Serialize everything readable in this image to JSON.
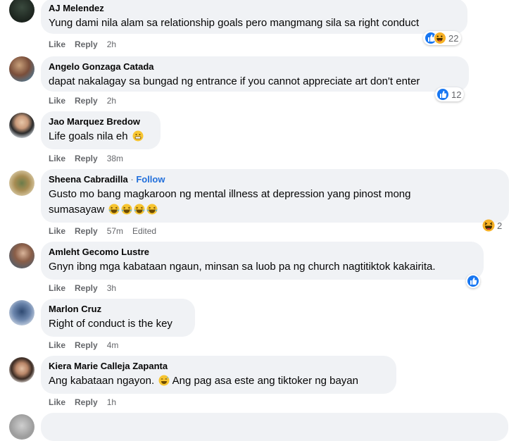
{
  "comments": [
    {
      "author": "AJ Melendez",
      "text": "Yung dami nila alam sa relationship goals pero mangmang sila sa right conduct",
      "like": "Like",
      "reply": "Reply",
      "time": "2h",
      "reaction_count": "22"
    },
    {
      "author": "Angelo Gonzaga Catada",
      "text": "dapat nakalagay sa bungad ng entrance if you cannot appreciate art don't enter",
      "like": "Like",
      "reply": "Reply",
      "time": "2h",
      "reaction_count": "12"
    },
    {
      "author": "Jao Marquez Bredow",
      "text": "Life goals nila eh",
      "like": "Like",
      "reply": "Reply",
      "time": "38m"
    },
    {
      "author": "Sheena Cabradilla",
      "follow": "Follow",
      "dot": "·",
      "text_line1": "Gusto mo bang magkaroon ng mental illness at depression yang pinost mong",
      "text_line2": "sumasayaw",
      "like": "Like",
      "reply": "Reply",
      "time": "57m",
      "edited": "Edited",
      "reaction_count": "2"
    },
    {
      "author": "Amleht Gecomo Lustre",
      "text": "Gnyn ibng mga kabataan ngaun, minsan sa luob pa ng church nagtitiktok kakairita.",
      "like": "Like",
      "reply": "Reply",
      "time": "3h"
    },
    {
      "author": "Marlon Cruz",
      "text": "Right of conduct is the key",
      "like": "Like",
      "reply": "Reply",
      "time": "4m"
    },
    {
      "author": "Kiera Marie Calleja Zapanta",
      "text_before": "Ang kabataan ngayon.",
      "text_after": "Ang pag asa este ang tiktoker ng bayan",
      "like": "Like",
      "reply": "Reply",
      "time": "1h"
    }
  ],
  "colors": {
    "bubble": "#f0f2f5",
    "like_blue": "#1877f2",
    "haha_yellow": "#f7b125",
    "follow_blue": "#216fdb",
    "meta_gray": "#65676b"
  }
}
